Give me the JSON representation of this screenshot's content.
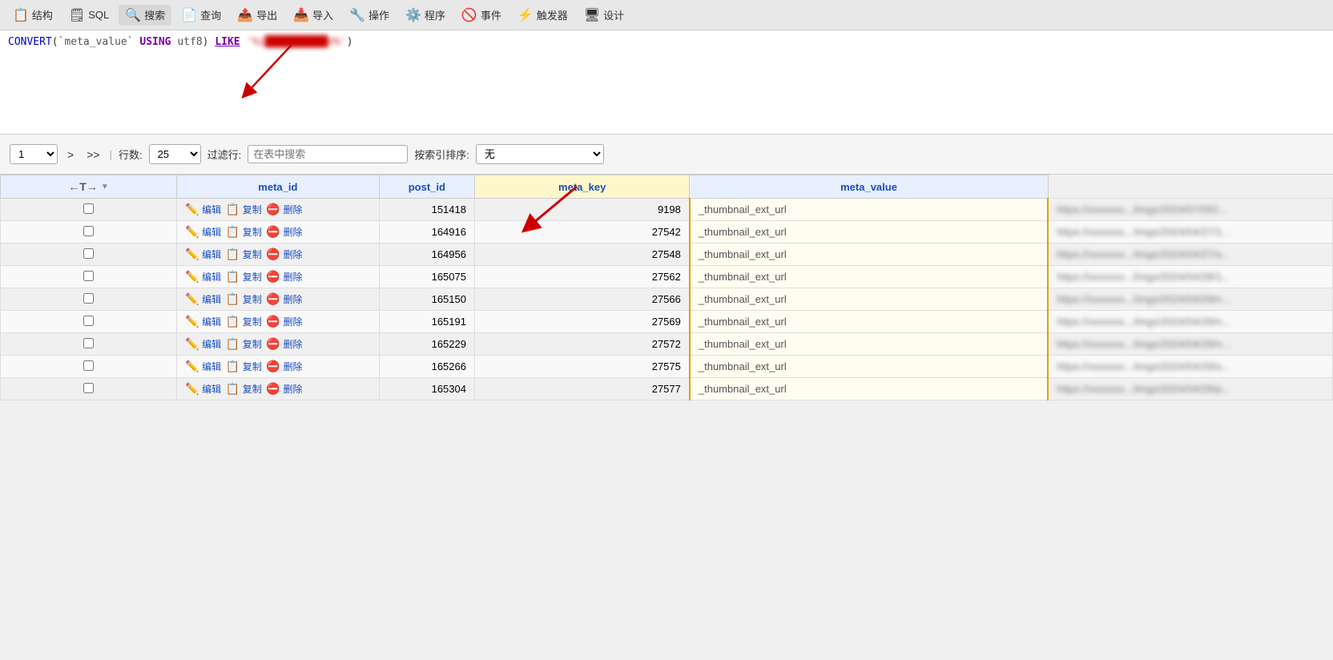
{
  "toolbar": {
    "items": [
      {
        "id": "structure",
        "label": "结构",
        "icon": "📋"
      },
      {
        "id": "sql",
        "label": "SQL",
        "icon": "🗒"
      },
      {
        "id": "search",
        "label": "搜索",
        "icon": "🔍"
      },
      {
        "id": "query",
        "label": "查询",
        "icon": "📄"
      },
      {
        "id": "export",
        "label": "导出",
        "icon": "📤"
      },
      {
        "id": "import",
        "label": "导入",
        "icon": "📥"
      },
      {
        "id": "operations",
        "label": "操作",
        "icon": "🔧"
      },
      {
        "id": "programs",
        "label": "程序",
        "icon": "⚙️"
      },
      {
        "id": "events",
        "label": "事件",
        "icon": "🚫"
      },
      {
        "id": "triggers",
        "label": "触发器",
        "icon": "⚡"
      },
      {
        "id": "settings",
        "label": "设计",
        "icon": "🖥"
      }
    ]
  },
  "sql_bar": {
    "code": "CONVERT(`meta_value` USING utf8) LIKE '%i[BLURRED]n%')"
  },
  "controls": {
    "page": "1",
    "page_placeholder": "1",
    "row_count_label": "行数:",
    "rows": "25",
    "filter_label": "过滤行:",
    "filter_placeholder": "在表中搜索",
    "sort_label": "按索引排序:",
    "sort_value": "无"
  },
  "table": {
    "columns": [
      "←T→",
      "meta_id",
      "post_id",
      "meta_key",
      "meta_value"
    ],
    "rows": [
      {
        "meta_id": "151418",
        "post_id": "9198",
        "meta_key": "_thumbnail_ext_url",
        "meta_value": "https://[blurred].../imgs/2024/07/05/i..."
      },
      {
        "meta_id": "164916",
        "post_id": "27542",
        "meta_key": "_thumbnail_ext_url",
        "meta_value": "https://[blurred].../imgs/2024/04/27/1..."
      },
      {
        "meta_id": "164956",
        "post_id": "27548",
        "meta_key": "_thumbnail_ext_url",
        "meta_value": "https://[blurred].../imgs/2024/04/27/o..."
      },
      {
        "meta_id": "165075",
        "post_id": "27562",
        "meta_key": "_thumbnail_ext_url",
        "meta_value": "https://[blurred].../imgs/2024/04/28/1..."
      },
      {
        "meta_id": "165150",
        "post_id": "27566",
        "meta_key": "_thumbnail_ext_url",
        "meta_value": "https://[blurred].../imgs/2024/04/29/n..."
      },
      {
        "meta_id": "165191",
        "post_id": "27569",
        "meta_key": "_thumbnail_ext_url",
        "meta_value": "https://[blurred].../imgs/2024/04/29/n..."
      },
      {
        "meta_id": "165229",
        "post_id": "27572",
        "meta_key": "_thumbnail_ext_url",
        "meta_value": "https://[blurred].../imgs/2024/04/29/n..."
      },
      {
        "meta_id": "165266",
        "post_id": "27575",
        "meta_key": "_thumbnail_ext_url",
        "meta_value": "https://[blurred].../imgs/2024/04/29/o..."
      },
      {
        "meta_id": "165304",
        "post_id": "27577",
        "meta_key": "_thumbnail_ext_url",
        "meta_value": "https://[blurred].../imgs/2024/04/29/p..."
      }
    ],
    "action_labels": {
      "edit": "编辑",
      "copy": "复制",
      "delete": "删除"
    }
  },
  "annotations": {
    "arrow1_label": "thumbnail ext url",
    "meta_key_col": "meta_key"
  }
}
